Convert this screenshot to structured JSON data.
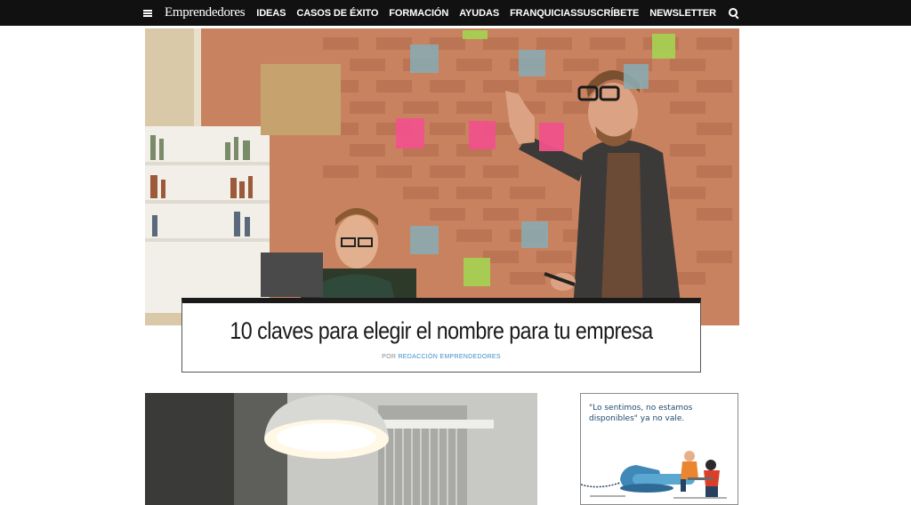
{
  "nav": {
    "menu_icon": "hamburger-menu-icon",
    "logo": "Emprendedores",
    "links": [
      "IDEAS",
      "CASOS DE ÉXITO",
      "FORMACIÓN",
      "AYUDAS",
      "FRANQUICIAS"
    ],
    "subscribe": "SUSCRÍBETE",
    "newsletter": "NEWSLETTER",
    "search_icon": "search-icon"
  },
  "article": {
    "title": "10 claves para elegir el nombre para tu empresa",
    "byline_prefix": "POR",
    "author": "REDACCIÓN EMPRENDEDORES"
  },
  "ad": {
    "text": "\"Lo sentimos, no estamos disponibles\" ya no vale."
  },
  "colors": {
    "navbar": "#111111",
    "author_link": "#3a8fc8",
    "ad_text": "#1e4a6e"
  }
}
